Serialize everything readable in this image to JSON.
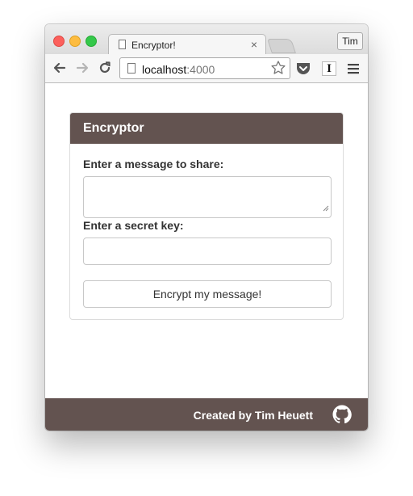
{
  "browser": {
    "tab_title": "Encryptor!",
    "tab_close_glyph": "×",
    "profile_name": "Tim",
    "url_host": "localhost",
    "url_port": ":4000",
    "icons": [
      "back-arrow-icon",
      "forward-arrow-icon",
      "reload-icon",
      "bookmark-star-icon",
      "pocket-icon",
      "instapaper-icon",
      "hamburger-menu-icon"
    ]
  },
  "app": {
    "panel_title": "Encryptor",
    "message_label": "Enter a message to share:",
    "message_value": "",
    "key_label": "Enter a secret key:",
    "key_value": "",
    "submit_label": "Encrypt my message!",
    "footer_credit": "Created by Tim Heuett",
    "footer_icon": "github-icon"
  },
  "colors": {
    "brand": "#635350",
    "close": "#fc605c",
    "minimize": "#fdbc40",
    "maximize": "#34c84a"
  }
}
